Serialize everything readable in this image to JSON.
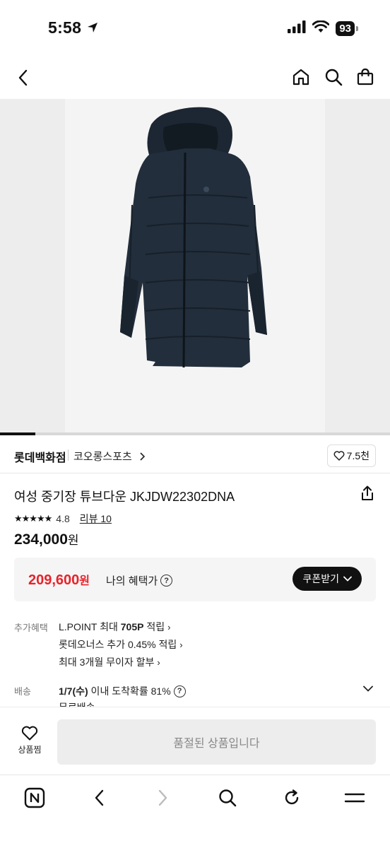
{
  "status": {
    "time": "5:58",
    "battery": "93"
  },
  "nav": {
    "back_icon": "chevron-left-icon",
    "home_icon": "home-icon",
    "search_icon": "search-icon",
    "cart_icon": "shopping-bag-icon"
  },
  "gallery": {
    "progress": 0.09
  },
  "brand": {
    "store": "롯데백화점",
    "brand_name": "코오롱스포츠",
    "likes": "7.5천"
  },
  "product": {
    "title": "여성 중기장 튜브다운 JKJDW22302DNA",
    "stars": "★★★★★",
    "rating": "4.8",
    "review_label": "리뷰 10",
    "price": "234,000",
    "price_unit": "원"
  },
  "benefit": {
    "sale_price": "209,600",
    "sale_unit": "원",
    "label": "나의 혜택가",
    "coupon_label": "쿠폰받기"
  },
  "extra": {
    "label": "추가혜택",
    "lpoint_prefix": "L.POINT 최대 ",
    "lpoint_bold": "705P",
    "lpoint_suffix": " 적립",
    "owners": "롯데오너스 추가 0.45% 적립",
    "installment": "최대 3개월 무이자 할부"
  },
  "delivery": {
    "label": "배송",
    "date": "1/7(수)",
    "text": " 이내 도착확률 81%",
    "clipped": "무료배송"
  },
  "bottom": {
    "wish_label": "상품찜",
    "soldout_label": "품절된 상품입니다"
  },
  "colors": {
    "sale": "#e8222b",
    "primary": "#111111"
  }
}
